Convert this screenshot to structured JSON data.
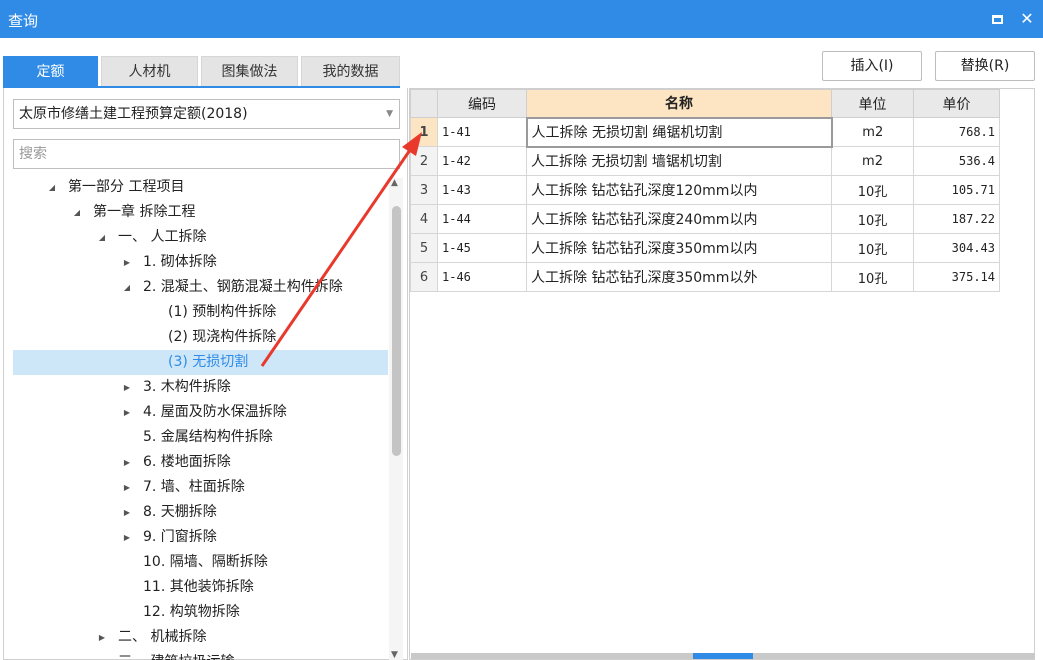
{
  "window": {
    "title": "查询"
  },
  "tabs": [
    "定额",
    "人材机",
    "图集做法",
    "我的数据"
  ],
  "active_tab": "定额",
  "quota_set": "太原市修缮土建工程预算定额(2018)",
  "search": {
    "placeholder": "搜索",
    "value": ""
  },
  "tree": [
    {
      "label": "第一部分 工程项目",
      "expanded": true
    },
    {
      "label": "第一章 拆除工程",
      "expanded": true
    },
    {
      "label": "一、 人工拆除",
      "expanded": true
    },
    {
      "label": "1. 砌体拆除",
      "expanded": false
    },
    {
      "label": "2. 混凝土、钢筋混凝土构件拆除",
      "expanded": true
    },
    {
      "label": "(1) 预制构件拆除"
    },
    {
      "label": "(2) 现浇构件拆除"
    },
    {
      "label": "(3) 无损切割",
      "selected": true
    },
    {
      "label": "3. 木构件拆除",
      "expanded": false
    },
    {
      "label": "4. 屋面及防水保温拆除",
      "expanded": false
    },
    {
      "label": "5. 金属结构构件拆除"
    },
    {
      "label": "6. 楼地面拆除",
      "expanded": false
    },
    {
      "label": "7. 墙、柱面拆除",
      "expanded": false
    },
    {
      "label": "8. 天棚拆除",
      "expanded": false
    },
    {
      "label": "9. 门窗拆除",
      "expanded": false
    },
    {
      "label": "10. 隔墙、隔断拆除"
    },
    {
      "label": "11. 其他装饰拆除"
    },
    {
      "label": "12. 构筑物拆除"
    },
    {
      "label": "二、 机械拆除",
      "expanded": false
    },
    {
      "label": "三、 建筑垃圾运输"
    }
  ],
  "actions": {
    "insert": "插入(I)",
    "replace": "替换(R)"
  },
  "grid": {
    "columns": [
      "编码",
      "名称",
      "单位",
      "单价"
    ],
    "rows": [
      {
        "num": "1",
        "code": "1-41",
        "name": "人工拆除 无损切割 绳锯机切割",
        "unit": "m2",
        "price": "768.1"
      },
      {
        "num": "2",
        "code": "1-42",
        "name": "人工拆除 无损切割 墙锯机切割",
        "unit": "m2",
        "price": "536.4"
      },
      {
        "num": "3",
        "code": "1-43",
        "name": "人工拆除 钻芯钻孔深度120mm以内",
        "unit": "10孔",
        "price": "105.71"
      },
      {
        "num": "4",
        "code": "1-44",
        "name": "人工拆除 钻芯钻孔深度240mm以内",
        "unit": "10孔",
        "price": "187.22"
      },
      {
        "num": "5",
        "code": "1-45",
        "name": "人工拆除 钻芯钻孔深度350mm以内",
        "unit": "10孔",
        "price": "304.43"
      },
      {
        "num": "6",
        "code": "1-46",
        "name": "人工拆除 钻芯钻孔深度350mm以外",
        "unit": "10孔",
        "price": "375.14"
      }
    ],
    "selected_row": 1
  },
  "colors": {
    "accent": "#2f8be6",
    "selection": "#cde6f8",
    "header_highlight": "#fde4c2",
    "annotation_arrow": "#e8392c"
  }
}
